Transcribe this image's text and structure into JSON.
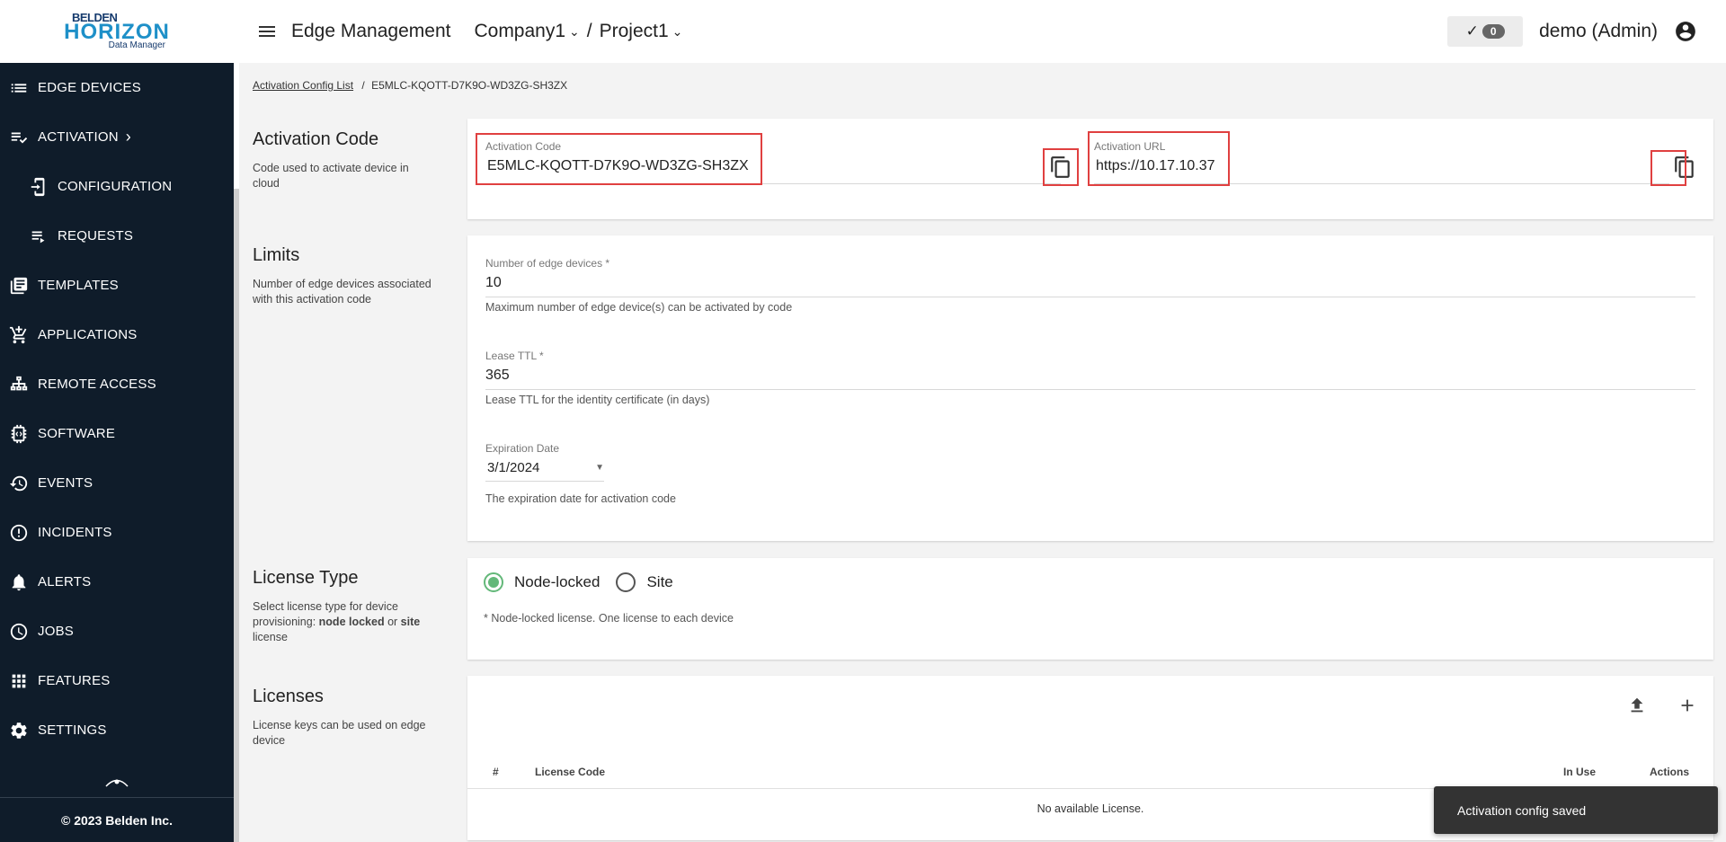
{
  "brand": {
    "line1": "BELDEN",
    "line2": "HORIZON",
    "line3": "Data Manager"
  },
  "sidebar": {
    "items": [
      {
        "label": "EDGE DEVICES",
        "icon": "list-icon"
      },
      {
        "label": "ACTIVATION",
        "icon": "playlist-check-icon"
      },
      {
        "label": "CONFIGURATION",
        "icon": "device-login-icon"
      },
      {
        "label": "REQUESTS",
        "icon": "playlist-play-icon"
      },
      {
        "label": "TEMPLATES",
        "icon": "library-books-icon"
      },
      {
        "label": "APPLICATIONS",
        "icon": "cart-add-icon"
      },
      {
        "label": "REMOTE ACCESS",
        "icon": "network-tree-icon"
      },
      {
        "label": "SOFTWARE",
        "icon": "chip-icon"
      },
      {
        "label": "EVENTS",
        "icon": "history-icon"
      },
      {
        "label": "INCIDENTS",
        "icon": "alert-circle-icon"
      },
      {
        "label": "ALERTS",
        "icon": "bell-icon"
      },
      {
        "label": "JOBS",
        "icon": "clock-icon"
      },
      {
        "label": "FEATURES",
        "icon": "apps-grid-icon"
      },
      {
        "label": "SETTINGS",
        "icon": "gear-icon"
      }
    ],
    "footer": "© 2023 Belden Inc."
  },
  "header": {
    "title": "Edge Management",
    "company": "Company1",
    "separator": "/",
    "project": "Project1",
    "badge_count": "0",
    "user": "demo (Admin)"
  },
  "breadcrumb": {
    "parent": "Activation Config List",
    "separator": "/",
    "current": "E5MLC-KQOTT-D7K9O-WD3ZG-SH3ZX"
  },
  "activation": {
    "title": "Activation Code",
    "desc": "Code used to activate device in cloud",
    "code_label": "Activation Code",
    "code_value": "E5MLC-KQOTT-D7K9O-WD3ZG-SH3ZX",
    "url_label": "Activation URL",
    "url_value": "https://10.17.10.37"
  },
  "limits": {
    "title": "Limits",
    "desc": "Number of edge devices associated with this activation code",
    "devices_label": "Number of edge devices *",
    "devices_value": "10",
    "devices_help": "Maximum number of edge device(s) can be activated by code",
    "ttl_label": "Lease TTL *",
    "ttl_value": "365",
    "ttl_help": "Lease TTL for the identity certificate (in days)",
    "exp_label": "Expiration Date",
    "exp_value": "3/1/2024",
    "exp_help": "The expiration date for activation code"
  },
  "license_type": {
    "title": "License Type",
    "desc_pre": "Select license type for device provisioning: ",
    "desc_b1": "node locked",
    "desc_mid": " or ",
    "desc_b2": "site",
    "desc_post": " license",
    "option1": "Node-locked",
    "option2": "Site",
    "selected": "Node-locked",
    "note": "* Node-locked license. One license to each device"
  },
  "licenses": {
    "title": "Licenses",
    "desc": "License keys can be used on edge device",
    "columns": [
      "#",
      "License Code",
      "In Use",
      "Actions"
    ],
    "empty": "No available License."
  },
  "toast": "Activation config saved"
}
